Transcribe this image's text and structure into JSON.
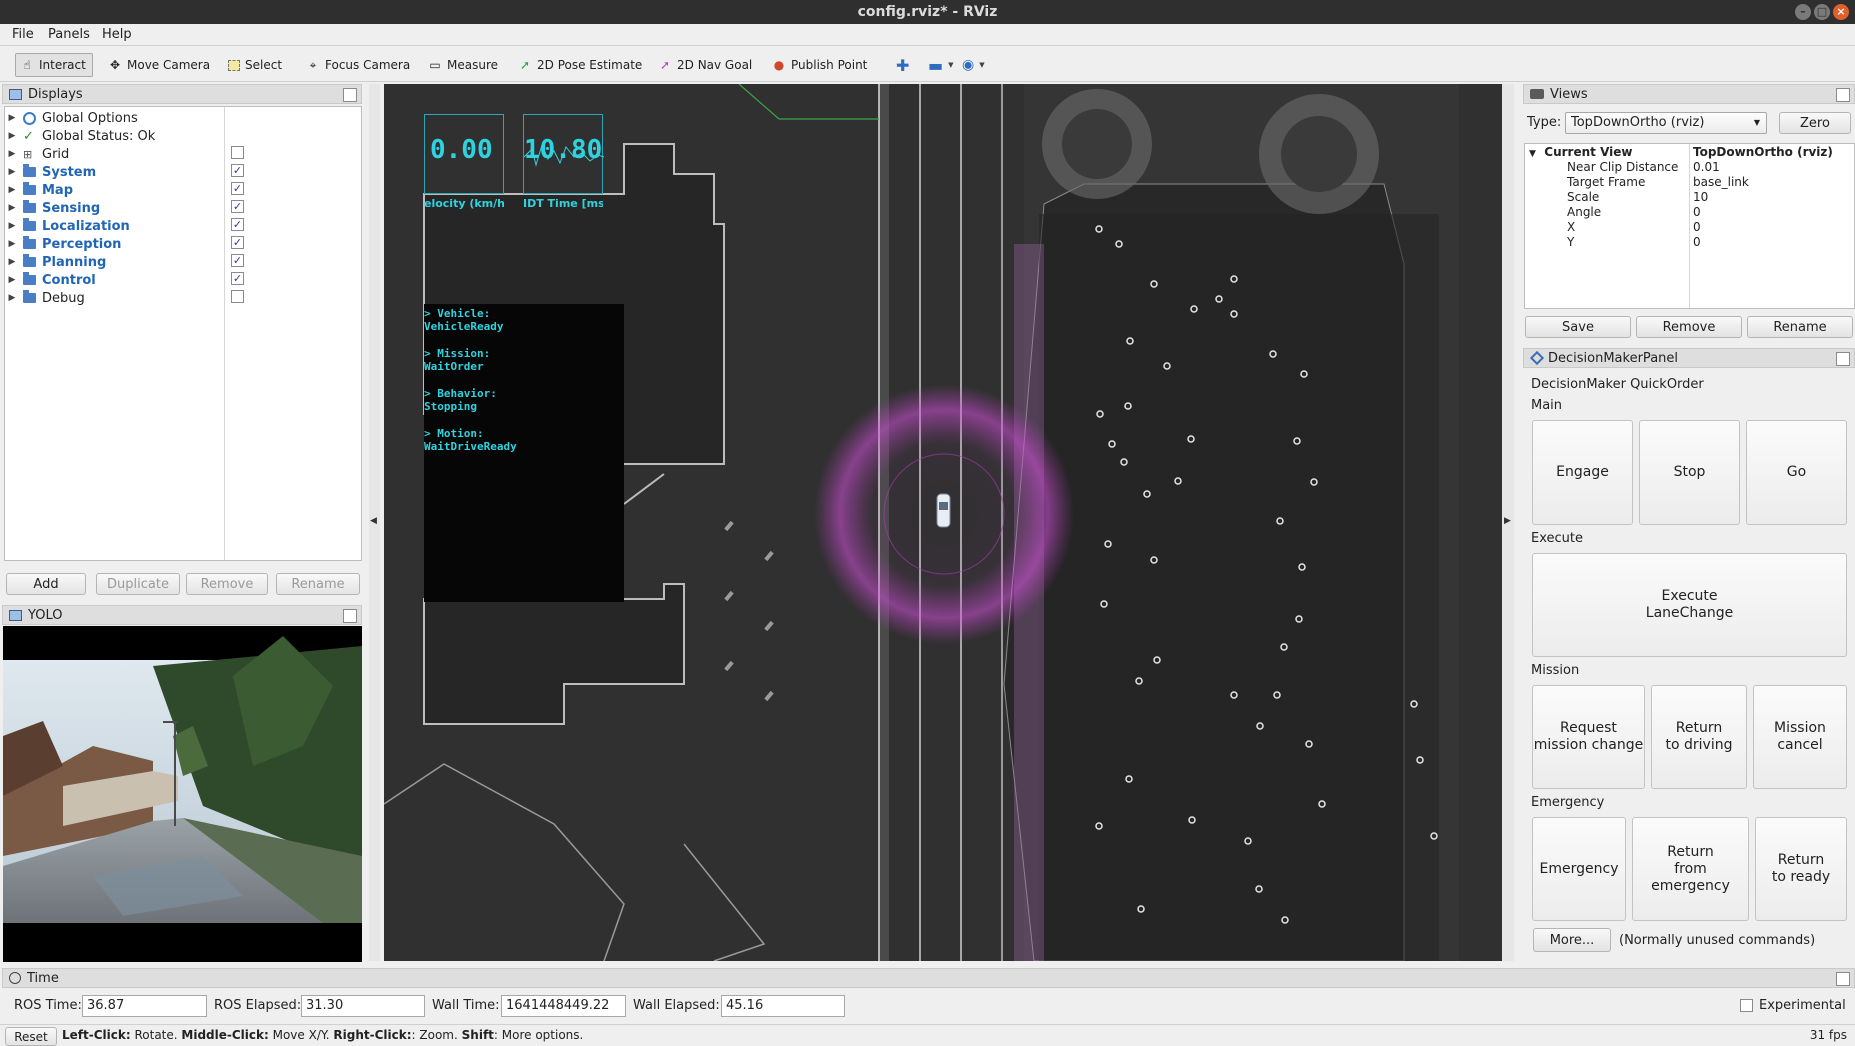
{
  "window": {
    "title": "config.rviz* - RViz"
  },
  "menu": {
    "file": "File",
    "panels": "Panels",
    "help": "Help"
  },
  "toolbar": {
    "interact": "Interact",
    "move_camera": "Move Camera",
    "select": "Select",
    "focus_camera": "Focus Camera",
    "measure": "Measure",
    "pose_estimate": "2D Pose Estimate",
    "nav_goal": "2D Nav Goal",
    "publish_point": "Publish Point"
  },
  "displays": {
    "title": "Displays",
    "items": [
      {
        "label": "Global Options",
        "checked": null
      },
      {
        "label": "Global Status: Ok",
        "checked": null
      },
      {
        "label": "Grid",
        "checked": false
      },
      {
        "label": "System",
        "checked": true
      },
      {
        "label": "Map",
        "checked": true
      },
      {
        "label": "Sensing",
        "checked": true
      },
      {
        "label": "Localization",
        "checked": true
      },
      {
        "label": "Perception",
        "checked": true
      },
      {
        "label": "Planning",
        "checked": true
      },
      {
        "label": "Control",
        "checked": true
      },
      {
        "label": "Debug",
        "checked": false
      }
    ],
    "buttons": {
      "add": "Add",
      "duplicate": "Duplicate",
      "remove": "Remove",
      "rename": "Rename"
    }
  },
  "yolo": {
    "title": "YOLO"
  },
  "viewport": {
    "velocity_value": "0.00",
    "velocity_label": "elocity (km/h",
    "ndt_value": "10.80",
    "ndt_label": "IDT Time [ms",
    "state": [
      {
        "key": "> Vehicle:",
        "value": "VehicleReady"
      },
      {
        "key": "> Mission:",
        "value": "WaitOrder"
      },
      {
        "key": "> Behavior:",
        "value": "Stopping"
      },
      {
        "key": "> Motion:",
        "value": "WaitDriveReady"
      }
    ]
  },
  "views": {
    "title": "Views",
    "type_label": "Type:",
    "type_value": "TopDownOrtho (rviz)",
    "zero": "Zero",
    "current_view": "Current View",
    "current_view_value": "TopDownOrtho (rviz)",
    "props": [
      {
        "name": "Near Clip Distance",
        "value": "0.01"
      },
      {
        "name": "Target Frame",
        "value": "base_link"
      },
      {
        "name": "Scale",
        "value": "10"
      },
      {
        "name": "Angle",
        "value": "0"
      },
      {
        "name": "X",
        "value": "0"
      },
      {
        "name": "Y",
        "value": "0"
      }
    ],
    "save": "Save",
    "remove": "Remove",
    "rename": "Rename"
  },
  "decision": {
    "title": "DecisionMakerPanel",
    "heading": "DecisionMaker QuickOrder",
    "main": "Main",
    "engage": "Engage",
    "stop": "Stop",
    "go": "Go",
    "execute": "Execute",
    "execute_lane_change": "Execute\nLaneChange",
    "mission": "Mission",
    "request_mission_change": "Request\nmission change",
    "return_to_driving": "Return\nto driving",
    "mission_cancel": "Mission\ncancel",
    "emergency_label": "Emergency",
    "emergency": "Emergency",
    "return_from_emergency": "Return\nfrom emergency",
    "return_to_ready": "Return\nto ready",
    "more": "More...",
    "more_note": "(Normally unused commands)"
  },
  "time": {
    "title": "Time",
    "ros_time_label": "ROS Time:",
    "ros_time": "36.87",
    "ros_elapsed_label": "ROS Elapsed:",
    "ros_elapsed": "31.30",
    "wall_time_label": "Wall Time:",
    "wall_time": "1641448449.22",
    "wall_elapsed_label": "Wall Elapsed:",
    "wall_elapsed": "45.16",
    "experimental": "Experimental"
  },
  "status": {
    "reset": "Reset",
    "left_click": "Left-Click:",
    "left_desc": " Rotate. ",
    "middle_click": "Middle-Click:",
    "middle_desc": " Move X/Y. ",
    "right_click": "Right-Click:",
    "right_desc": ": Zoom. ",
    "shift": "Shift",
    "shift_desc": ": More options.",
    "fps": "31 fps"
  },
  "colors": {
    "accent_blue": "#2166b5",
    "overlay_cyan": "#2fd3e0",
    "map_bg": "#2b2b2b"
  }
}
